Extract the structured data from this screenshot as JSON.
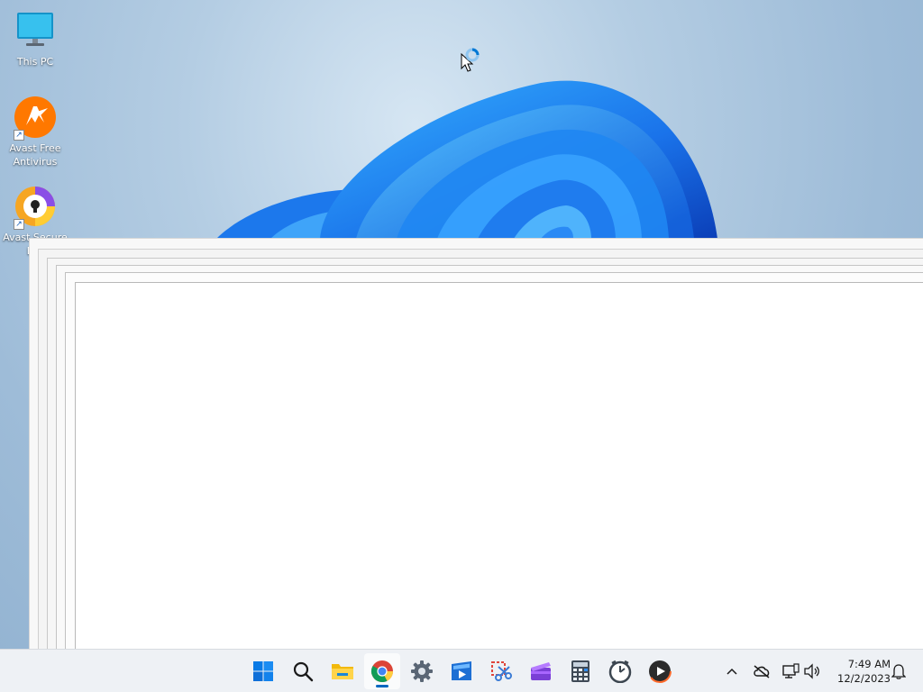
{
  "desktop": {
    "icons": [
      {
        "name": "this-pc",
        "label": "This PC",
        "icon": "monitor-icon"
      },
      {
        "name": "avast-free-antivirus",
        "label": "Avast Free Antivirus",
        "icon": "avast-icon"
      },
      {
        "name": "avast-secure-browser",
        "label": "Avast Secure Bro",
        "icon": "avast-secure-browser-icon"
      }
    ]
  },
  "taskbar": {
    "apps": [
      {
        "name": "start",
        "icon": "windows-start-icon"
      },
      {
        "name": "search",
        "icon": "search-icon"
      },
      {
        "name": "file-explorer",
        "icon": "folder-icon"
      },
      {
        "name": "chrome",
        "icon": "chrome-icon",
        "active": true
      },
      {
        "name": "settings",
        "icon": "gear-icon"
      },
      {
        "name": "media-player",
        "icon": "media-player-icon"
      },
      {
        "name": "snipping-tool",
        "icon": "snipping-tool-icon"
      },
      {
        "name": "clipchamp",
        "icon": "clipchamp-icon"
      },
      {
        "name": "calculator",
        "icon": "calculator-icon"
      },
      {
        "name": "clock",
        "icon": "alarm-clock-icon"
      },
      {
        "name": "player",
        "icon": "play-icon"
      }
    ],
    "tray": {
      "chevron": "chevron-up-icon",
      "onedrive": "cloud-off-icon",
      "network": "network-icon",
      "volume": "speaker-icon",
      "notifications": "bell-icon"
    },
    "clock": {
      "time": "7:49 AM",
      "date": "12/2/2023"
    }
  },
  "colors": {
    "accent": "#0067c0",
    "bloom_blue": "#1e7ff0",
    "taskbar_bg": "#eef1f5"
  }
}
